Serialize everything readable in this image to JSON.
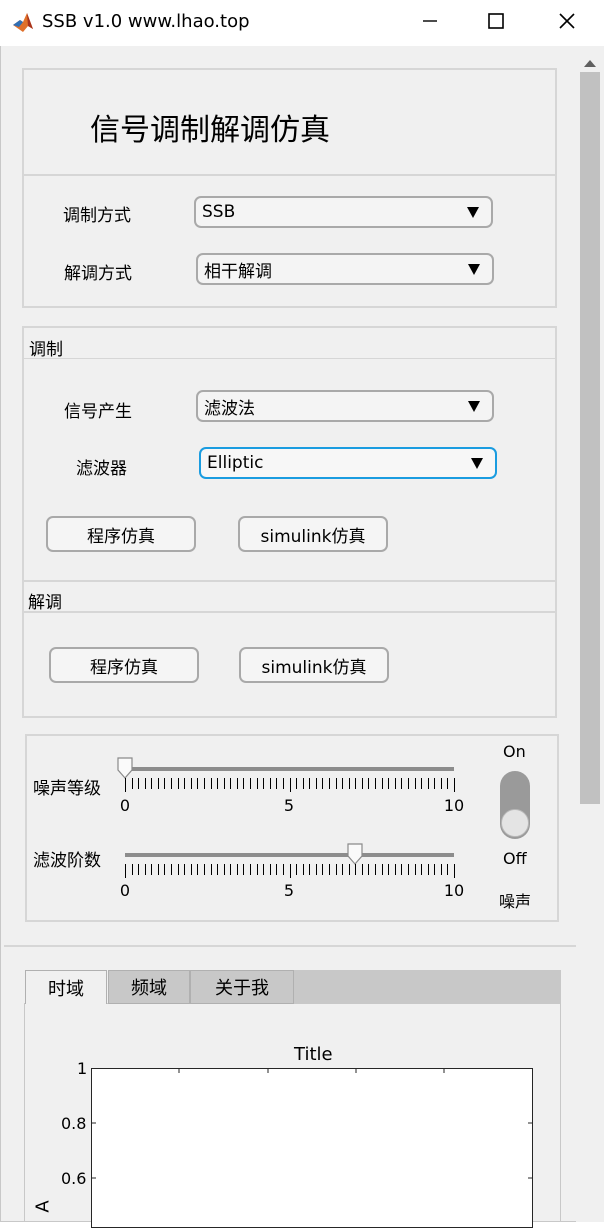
{
  "window": {
    "title": "SSB v1.0 www.lhao.top",
    "icons": [
      "matlab-icon",
      "minimize-icon",
      "maximize-icon",
      "close-icon"
    ]
  },
  "header": {
    "title": "信号调制解调仿真"
  },
  "modulation_method": {
    "label": "调制方式",
    "value": "SSB"
  },
  "demodulation_method": {
    "label": "解调方式",
    "value": "相干解调"
  },
  "modulate_section": {
    "title": "调制",
    "signal": {
      "label": "信号产生",
      "value": "滤波法"
    },
    "filter": {
      "label": "滤波器",
      "value": "Elliptic"
    },
    "program_button": "程序仿真",
    "simulink_button": "simulink仿真"
  },
  "demodulate_section": {
    "title": "解调",
    "program_button": "程序仿真",
    "simulink_button": "simulink仿真"
  },
  "controls": {
    "noise_level": {
      "label": "噪声等级",
      "value": 0,
      "min": "0",
      "mid": "5",
      "max": "10"
    },
    "filter_order": {
      "label": "滤波阶数",
      "value": 7,
      "min": "0",
      "mid": "5",
      "max": "10"
    },
    "noise_switch": {
      "on": "On",
      "off": "Off",
      "label": "噪声",
      "state": "off"
    }
  },
  "tabs": [
    {
      "label": "时域",
      "active": true
    },
    {
      "label": "频域",
      "active": false
    },
    {
      "label": "关于我",
      "active": false
    }
  ],
  "plot": {
    "title": "Title",
    "ylabel": "A",
    "yticks": [
      "1",
      "0.8",
      "0.6"
    ]
  },
  "colors": {
    "focus_border": "#1a9ce0",
    "panel_bg": "#f0f0f0"
  }
}
